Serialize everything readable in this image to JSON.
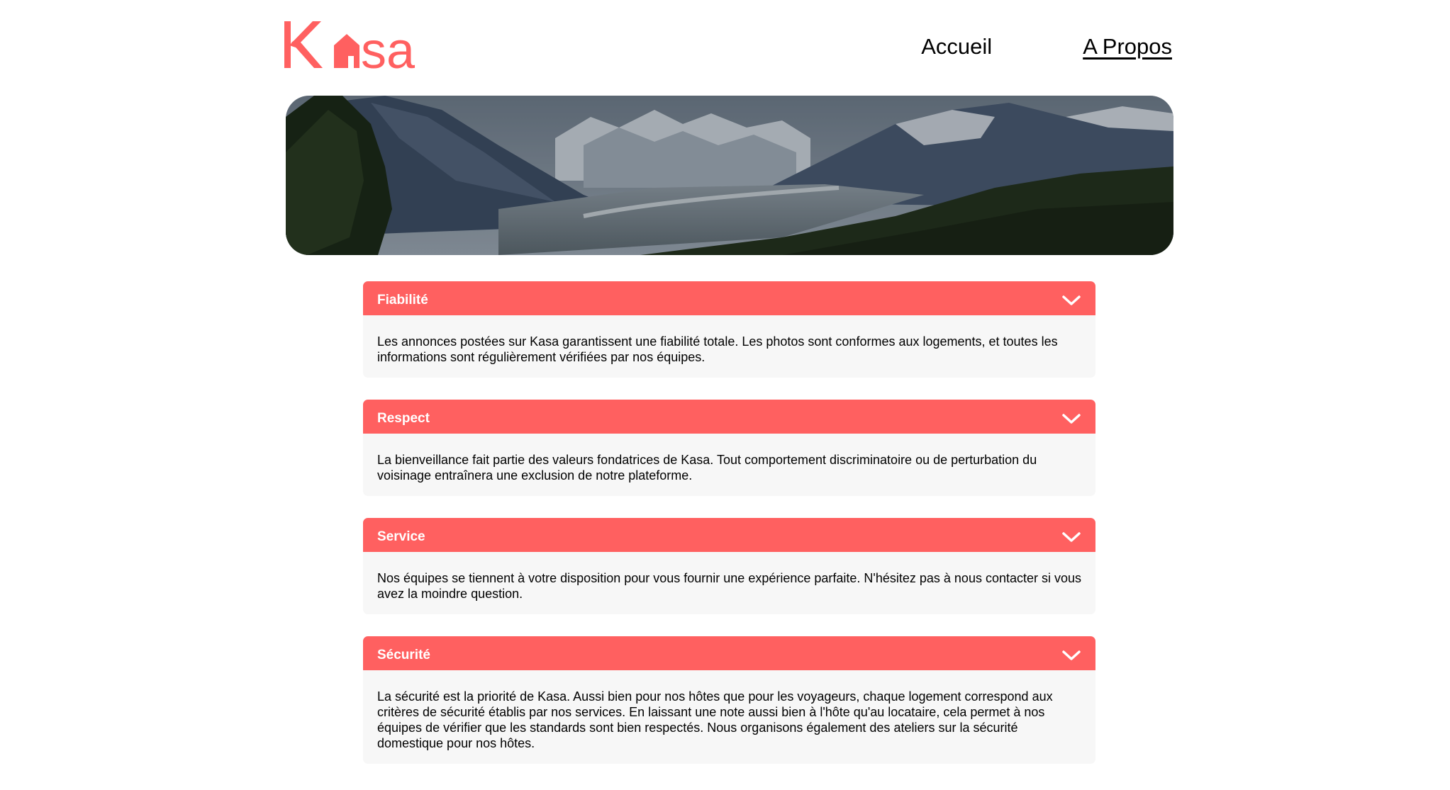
{
  "brand": {
    "name": "Kasa",
    "color": "#ff6060"
  },
  "nav": {
    "items": [
      {
        "label": "Accueil"
      },
      {
        "label": "A Propos"
      }
    ]
  },
  "banner": {
    "icon": "mountain-landscape-image"
  },
  "collapses": [
    {
      "title": "Fiabilité",
      "text": "Les annonces postées sur Kasa garantissent une fiabilité totale. Les photos sont conformes aux logements, et toutes les informations sont régulièrement vérifiées par nos équipes."
    },
    {
      "title": "Respect",
      "text": "La bienveillance fait partie des valeurs fondatrices de Kasa. Tout comportement discriminatoire ou de perturbation du voisinage entraînera une exclusion de notre plateforme."
    },
    {
      "title": "Service",
      "text": "Nos équipes se tiennent à votre disposition pour vous fournir une expérience parfaite. N'hésitez pas à nous contacter si vous avez la moindre question."
    },
    {
      "title": "Sécurité",
      "text": "La sécurité est la priorité de Kasa. Aussi bien pour nos hôtes que pour les voyageurs, chaque logement correspond aux critères de sécurité établis par nos services. En laissant une note aussi bien à l'hôte qu'au locataire, cela permet à nos équipes de vérifier que les standards sont bien respectés. Nous organisons également des ateliers sur la sécurité domestique pour nos hôtes."
    }
  ],
  "icons": {
    "chevron": "chevron-down-icon",
    "logo": "kasa-logo"
  }
}
